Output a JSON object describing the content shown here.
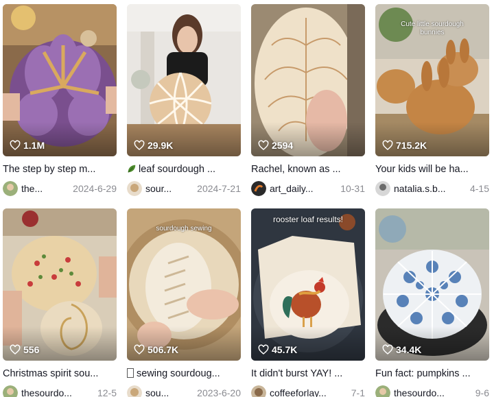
{
  "videos": [
    {
      "views": "1.1M",
      "title": "The step by step m...",
      "author": "the...",
      "date": "2024-6-29",
      "overlay": ""
    },
    {
      "views": "29.9K",
      "title": "leaf sourdough ...",
      "author": "sour...",
      "date": "2024-7-21",
      "overlay": "",
      "title_icon": "leaf-emoji"
    },
    {
      "views": "2594",
      "title": "Rachel, known as ...",
      "author": "art_daily...",
      "date": "10-31",
      "overlay": ""
    },
    {
      "views": "715.2K",
      "title": "Your kids will be ha...",
      "author": "natalia.s.b...",
      "date": "4-15",
      "overlay": "Cute little sourdough bunnies"
    },
    {
      "views": "556",
      "title": "Christmas spirit sou...",
      "author": "thesourdo...",
      "date": "12-5",
      "overlay": ""
    },
    {
      "views": "506.7K",
      "title": "sewing sourdoug...",
      "author": "sou...",
      "date": "2023-6-20",
      "overlay": "sourdough sewing",
      "title_icon": "missing-glyph"
    },
    {
      "views": "45.7K",
      "title": "It didn't burst YAY! ...",
      "author": "coffeeforlay...",
      "date": "7-1",
      "overlay": "rooster loaf results!"
    },
    {
      "views": "34.4K",
      "title": "Fun fact: pumpkins ...",
      "author": "thesourdo...",
      "date": "9-6",
      "overlay": ""
    }
  ],
  "colors": {
    "accent": "#161823",
    "meta_gray": "#8a8b91"
  }
}
